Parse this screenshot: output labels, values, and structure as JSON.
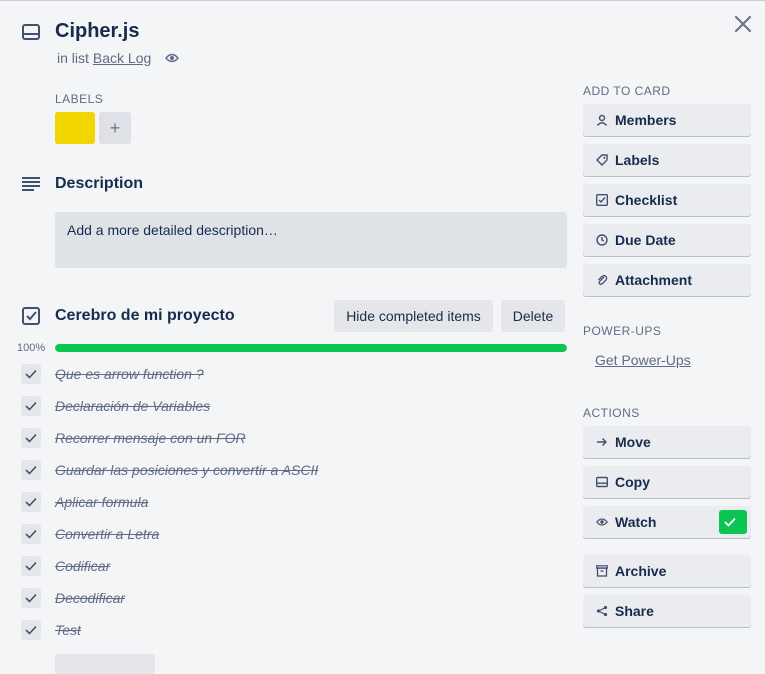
{
  "card": {
    "title": "Cipher.js",
    "in_list_prefix": "in list",
    "list_name": "Back Log"
  },
  "labels": {
    "heading": "Labels",
    "items": [
      {
        "color": "#f2d600"
      }
    ],
    "add_symbol": "+"
  },
  "description": {
    "heading": "Description",
    "placeholder": "Add a more detailed description…"
  },
  "checklist": {
    "title": "Cerebro de mi proyecto",
    "hide_completed_label": "Hide completed items",
    "delete_label": "Delete",
    "progress_text": "100%",
    "progress_fraction": 1.0,
    "progress_color": "#0bc451",
    "items": [
      {
        "text": "Que es arrow function ?",
        "checked": true
      },
      {
        "text": "Declaración de Variables",
        "checked": true
      },
      {
        "text": "Recorrer mensaje con un FOR",
        "checked": true
      },
      {
        "text": "Guardar las posiciones y convertir a ASCII",
        "checked": true
      },
      {
        "text": "Aplicar formula",
        "checked": true
      },
      {
        "text": "Convertir a Letra",
        "checked": true
      },
      {
        "text": "Codificar",
        "checked": true
      },
      {
        "text": "Decodificar",
        "checked": true
      },
      {
        "text": "Test",
        "checked": true
      }
    ]
  },
  "sidebar": {
    "add_to_card_heading": "Add to card",
    "add_to_card": [
      {
        "label": "Members",
        "icon": "person-icon"
      },
      {
        "label": "Labels",
        "icon": "tag-icon"
      },
      {
        "label": "Checklist",
        "icon": "checklist-icon"
      },
      {
        "label": "Due Date",
        "icon": "clock-icon"
      },
      {
        "label": "Attachment",
        "icon": "paperclip-icon"
      }
    ],
    "powerups_heading": "Power-Ups",
    "powerups_link": "Get Power-Ups",
    "actions_heading": "Actions",
    "actions": [
      {
        "label": "Move",
        "icon": "arrow-right-icon"
      },
      {
        "label": "Copy",
        "icon": "card-icon"
      },
      {
        "label": "Watch",
        "icon": "eye-icon",
        "active": true
      },
      {
        "label": "Archive",
        "icon": "archive-icon"
      },
      {
        "label": "Share",
        "icon": "share-icon"
      }
    ]
  },
  "colors": {
    "accent_green": "#0bc451",
    "label_yellow": "#f2d600"
  }
}
